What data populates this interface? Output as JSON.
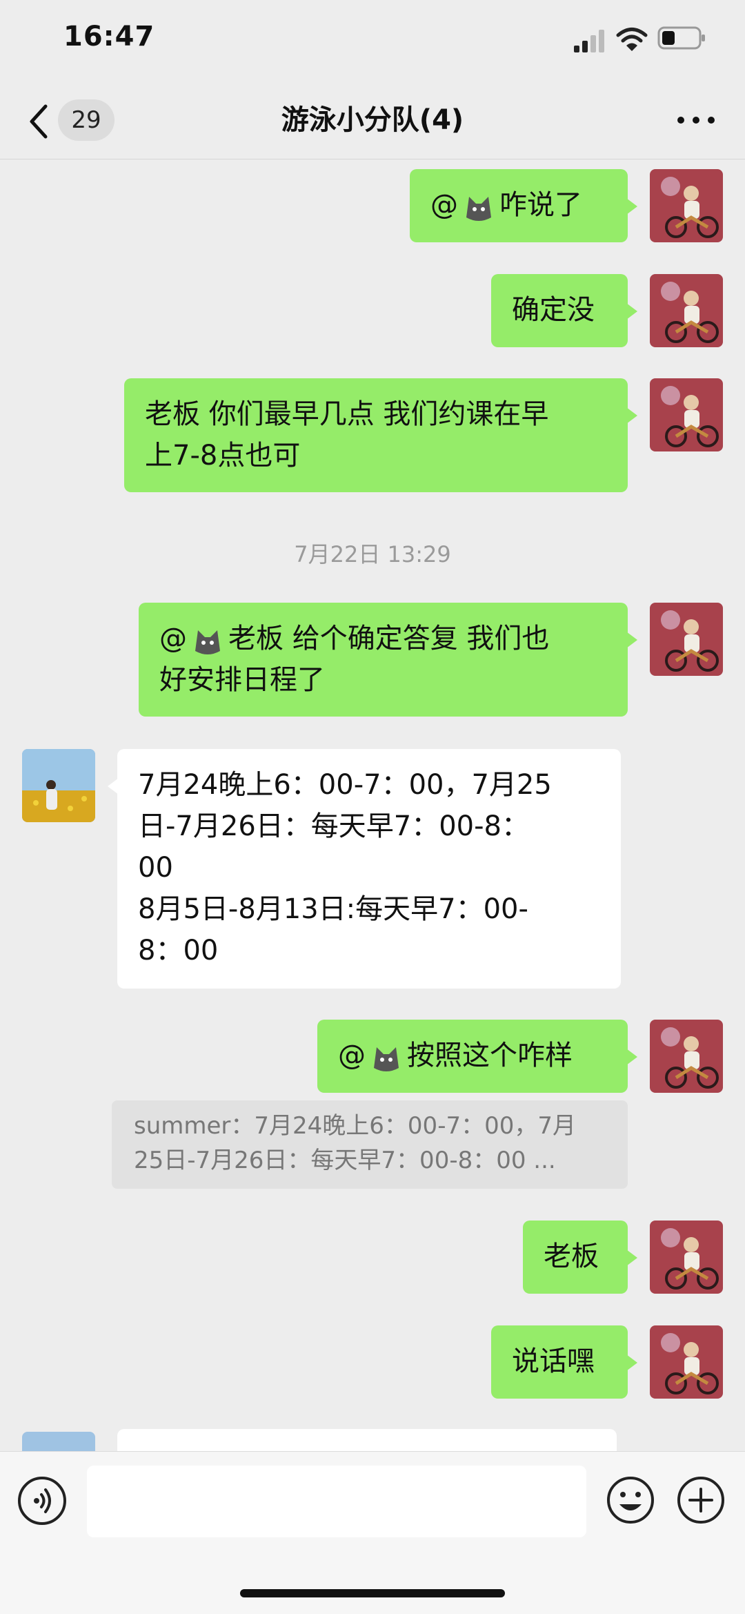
{
  "status_bar": {
    "time": "16:47",
    "battery_level": 0.35
  },
  "nav": {
    "back_count": "29",
    "title": "游泳小分队(4)"
  },
  "messages": [
    {
      "parts": [
        "@",
        "咋说了"
      ]
    },
    {
      "text": "确定没"
    },
    {
      "lines": [
        "老板 你们最早几点  我们约课在早",
        "上7-8点也可"
      ]
    },
    {
      "line1_tail": "老板 给个确定答复  我们也",
      "line2": "好安排日程了"
    },
    {
      "lines": [
        "7月24晚上6：00-7：00，7月25",
        "日-7月26日：每天早7：00-8：",
        "00",
        "8月5日-8月13日:每天早7：00-",
        "8：00"
      ]
    },
    {
      "tail": "按照这个咋样"
    },
    {
      "text": "老板"
    },
    {
      "text": "说话嘿"
    }
  ],
  "timestamp": "7月22日 13:29",
  "quote": {
    "lines": [
      "summer：7月24晚上6：00-7：00，7月",
      "25日-7月26日：每天早7：00-8：00 ..."
    ]
  },
  "input": {
    "value": ""
  },
  "colors": {
    "bubble_self": "#95ec69",
    "bubble_other": "#ffffff",
    "background": "#ededed"
  },
  "icons": [
    "signal-icon",
    "wifi-icon",
    "battery-icon",
    "back-chevron-icon",
    "more-icon",
    "voice-icon",
    "emoji-icon",
    "plus-icon",
    "wolf-emoji-icon"
  ]
}
